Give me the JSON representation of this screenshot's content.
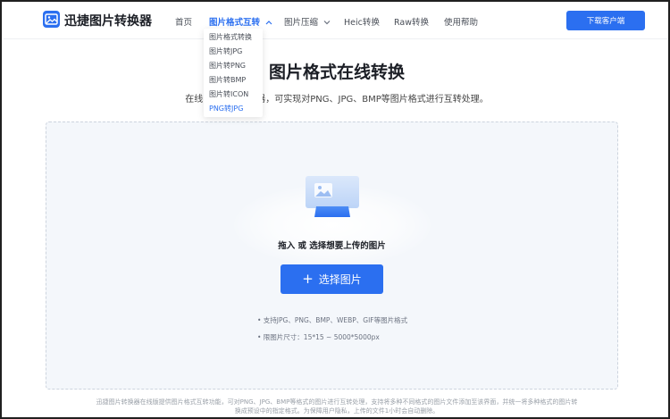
{
  "header": {
    "logo_text": "迅捷图片转换器",
    "nav": [
      {
        "label": "首页"
      },
      {
        "label": "图片格式互转"
      },
      {
        "label": "图片压缩"
      },
      {
        "label": "Heic转换"
      },
      {
        "label": "Raw转换"
      },
      {
        "label": "使用帮助"
      }
    ],
    "download_label": "下载客户端"
  },
  "dropdown": {
    "items": [
      {
        "label": "图片格式转换"
      },
      {
        "label": "图片转JPG"
      },
      {
        "label": "图片转PNG"
      },
      {
        "label": "图片转BMP"
      },
      {
        "label": "图片转ICON"
      },
      {
        "label": "PNG转JPG"
      }
    ]
  },
  "main": {
    "title": "图片格式在线转换",
    "subtitle": "在线图片格式转换器，可实现对PNG、JPG、BMP等图片格式进行互转处理。"
  },
  "upload": {
    "title": "拖入 或 选择想要上传的图片",
    "button_label": "选择图片",
    "hints": [
      "• 支持JPG、PNG、BMP、WEBP、GIF等图片格式",
      "• 限图片尺寸：15*15 ~ 5000*5000px"
    ]
  },
  "footer": {
    "line1": "迅捷图片转换器在线版提供图片格式互转功能，可对PNG、JPG、BMP等格式的图片进行互转处理，支持将多种不同格式的图片文件添加至该界面，并统一将多种格式的图片转",
    "line2": "换成预设中的指定格式。为保障用户隐私，上传的文件1小时会自动删除。"
  },
  "colors": {
    "accent": "#2b6ff0",
    "upload_bg": "#f4f7fb"
  },
  "icons": {
    "logo": "image-convert-icon",
    "nav_arrow": "chevron-down-icon",
    "upload": "picture-upload-icon",
    "button": "plus-icon"
  }
}
